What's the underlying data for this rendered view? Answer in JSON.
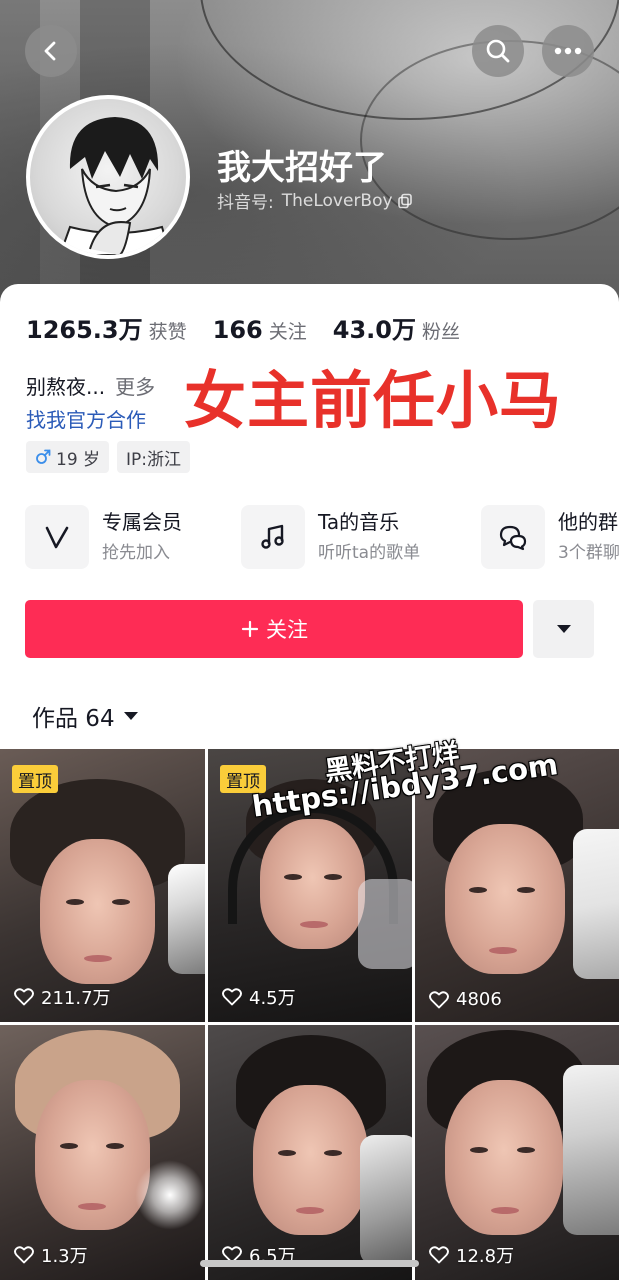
{
  "profile": {
    "nickname": "我大招好了",
    "douyin_id_label": "抖音号:",
    "douyin_id": "TheLoverBoy"
  },
  "stats": [
    {
      "value": "1265.3万",
      "label": "获赞"
    },
    {
      "value": "166",
      "label": "关注"
    },
    {
      "value": "43.0万",
      "label": "粉丝"
    }
  ],
  "bio": {
    "text": "别熬夜...",
    "more": "更多",
    "cooperation": "找我官方合作"
  },
  "overlay_text": "女主前任小马",
  "tags": {
    "gender_age": "19 岁",
    "ip": "IP:浙江"
  },
  "features": [
    {
      "title": "专属会员",
      "subtitle": "抢先加入",
      "icon": "v-logo-icon"
    },
    {
      "title": "Ta的音乐",
      "subtitle": "听听ta的歌单",
      "icon": "music-note-icon"
    },
    {
      "title": "他的群",
      "subtitle": "3个群聊",
      "icon": "group-chat-icon"
    }
  ],
  "actions": {
    "follow": "关注"
  },
  "works": {
    "label": "作品 64"
  },
  "videos": [
    {
      "likes": "211.7万",
      "pinned": "置顶"
    },
    {
      "likes": "4.5万",
      "pinned": "置顶"
    },
    {
      "likes": "4806"
    },
    {
      "likes": "1.3万"
    },
    {
      "likes": "6.5万"
    },
    {
      "likes": "12.8万"
    }
  ],
  "watermark": {
    "line1": "黑料不打烊",
    "line2": "https://ibdy37.com"
  },
  "colors": {
    "follow": "#fe2c55",
    "link": "#2b5bb8",
    "overlay": "#e8312a",
    "pin": "#facd3a"
  }
}
